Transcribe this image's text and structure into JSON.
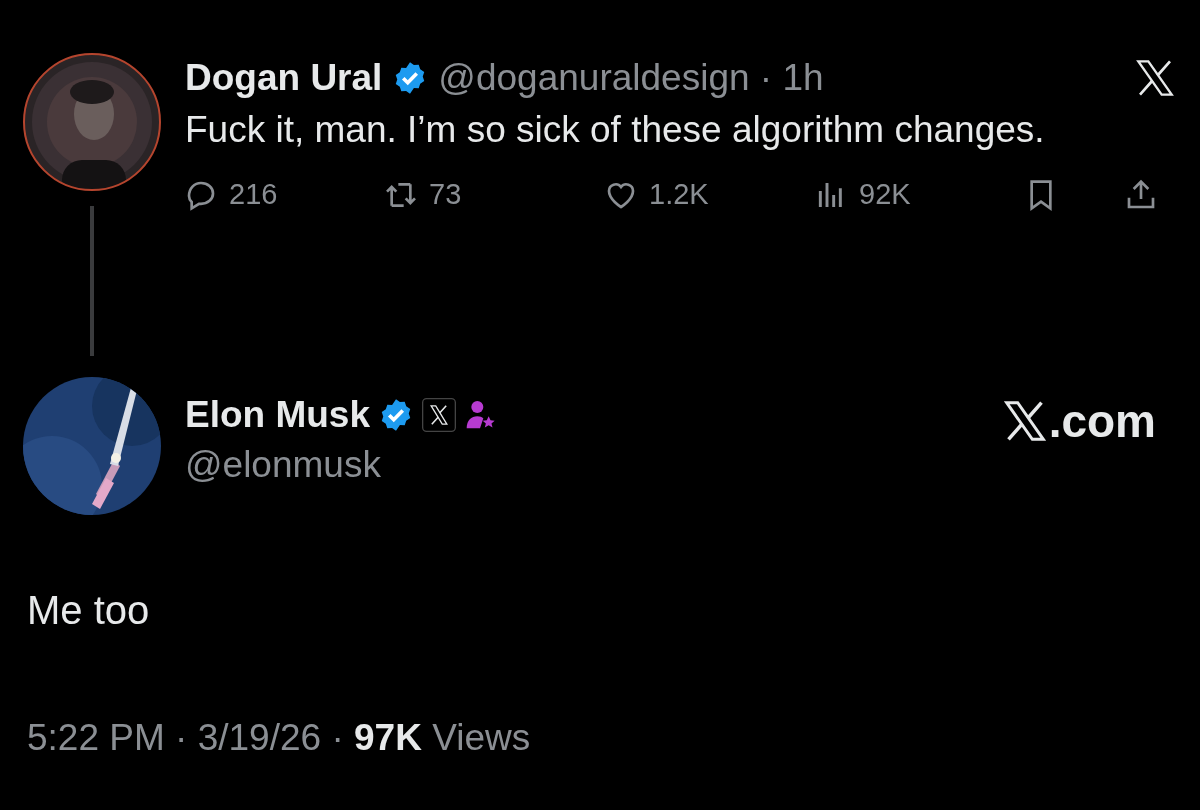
{
  "original_post": {
    "author": {
      "name": "Dogan Ural",
      "verified": true,
      "meta": "@doganuraldesign · 1h"
    },
    "text": "Fuck it, man. I’m so sick of these algorithm changes.",
    "actions": [
      {
        "kind": "reply",
        "count": "216"
      },
      {
        "kind": "repost",
        "count": "73"
      },
      {
        "kind": "like",
        "count": "1.2K"
      },
      {
        "kind": "views",
        "count": "92K"
      },
      {
        "kind": "bookmark"
      },
      {
        "kind": "share"
      }
    ]
  },
  "reply": {
    "author": {
      "name": "Elon Musk",
      "verified": true,
      "affiliate_badge": true,
      "subscriber_badge": true,
      "handle": "@elonmusk"
    },
    "site_link": ".com",
    "text": "Me too",
    "footer": "5:22 PM · 3/19/26 · **97K** Views"
  }
}
